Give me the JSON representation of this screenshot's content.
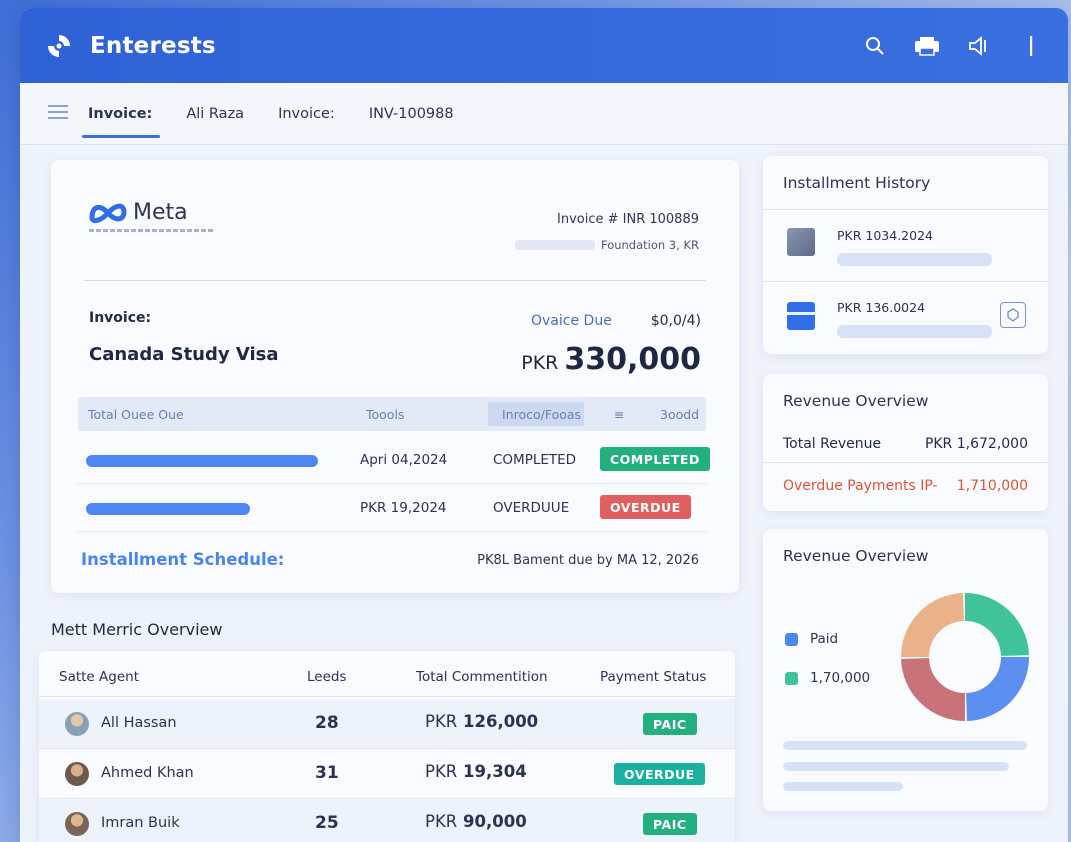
{
  "app": {
    "title": "Enterests"
  },
  "titlebar_icons": [
    "search-icon",
    "printer-icon",
    "speaker-icon",
    "more-icon"
  ],
  "nav": {
    "items": [
      "Invoice:",
      "Ali Raza",
      "Invoice:",
      "INV-100988"
    ]
  },
  "invoice": {
    "brand": "Meta",
    "number": "Invoice # INR 100889",
    "sub": "Foundation 3, KR",
    "label": "Invoice:",
    "title": "Canada Study Visa",
    "due_label": "Ovaice Due",
    "due_value": "$0,0/4)",
    "currency": "PKR",
    "amount": "330,000",
    "table_headers": [
      "Total Ouee Oue",
      "Toools",
      "Inroco/Fooas",
      "≡",
      "3oodd"
    ],
    "rows": [
      {
        "date": "Apri 04,2024",
        "status": "COMPLETED",
        "badge": "COMPLETED",
        "badge_color": "#22b07e"
      },
      {
        "date": "PKR 19,2024",
        "status": "OVERDUUE",
        "badge": "OVERDUE",
        "badge_color": "#e0605f"
      }
    ],
    "schedule_label": "Installment Schedule:",
    "schedule_note": "PK8L Bament due by MA 12, 2026"
  },
  "metrics": {
    "title": "Mett Merric Overview",
    "headers": [
      "Satte Agent",
      "Leeds",
      "Total Commentition",
      "Payment Status"
    ],
    "rows": [
      {
        "name": "All Hassan",
        "leads": "28",
        "currency": "PKR",
        "commission": "126,000",
        "status": "PAIC"
      },
      {
        "name": "Ahmed Khan",
        "leads": "31",
        "currency": "PKR",
        "commission": "19,304",
        "status": "OVERDUE"
      },
      {
        "name": "Imran Buik",
        "leads": "25",
        "currency": "PKR",
        "commission": "90,000",
        "status": "PAIC"
      }
    ]
  },
  "history": {
    "title": "Installment History",
    "items": [
      "PKR 1034.2024",
      "PKR 136.0024"
    ]
  },
  "revenue": {
    "title": "Revenue Overview",
    "total_label": "Total Revenue",
    "total_value": "PKR 1,672,000",
    "overdue_label": "Overdue Payments IP-",
    "overdue_value": "1,710,000"
  },
  "revenue_chart": {
    "title": "Revenue Overview",
    "legend": [
      {
        "label": "Paid",
        "color": "#4d86f0"
      },
      {
        "label": "1,70,000",
        "color": "#3fc39a"
      }
    ]
  },
  "chart_data": {
    "type": "pie",
    "title": "Revenue Overview",
    "values": [
      25,
      25,
      25,
      25
    ],
    "colors": [
      "#3fc39a",
      "#5b8ff0",
      "#c9727a",
      "#eab289"
    ]
  }
}
